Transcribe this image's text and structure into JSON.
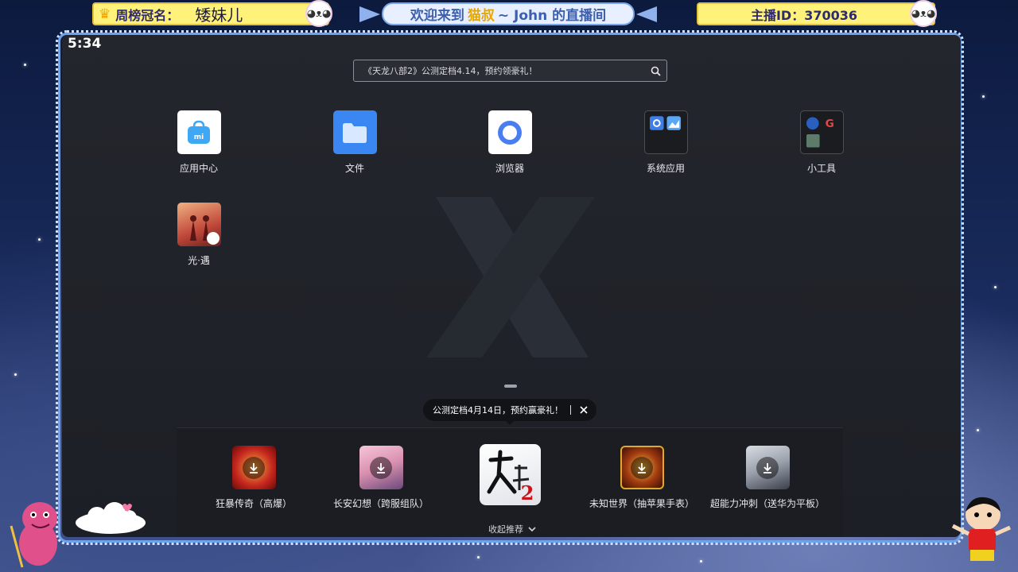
{
  "overlay": {
    "rank_label": "周榜冠名：",
    "rank_name": "矮妹儿",
    "welcome_prefix": "欢迎来到",
    "welcome_highlight": "猫叔",
    "welcome_suffix": "~ John 的直播间",
    "host_id": "主播ID：370036"
  },
  "status_bar": {
    "time": "5:34"
  },
  "search": {
    "placeholder": "《天龙八部2》公测定档4.14，预约领豪礼！",
    "icon": "search-icon"
  },
  "apps": [
    {
      "label": "应用中心",
      "icon": "app-center-icon"
    },
    {
      "label": "文件",
      "icon": "folder-icon"
    },
    {
      "label": "浏览器",
      "icon": "browser-icon"
    },
    {
      "label": "系统应用",
      "icon": "system-apps-folder-icon"
    },
    {
      "label": "小工具",
      "icon": "tools-folder-icon"
    },
    {
      "label": "光·遇",
      "icon": "sky-game-icon"
    }
  ],
  "tooltip": {
    "text": "公测定档4月14日，预约赢豪礼！",
    "close_icon": "close-icon"
  },
  "recommended": [
    {
      "label": "狂暴传奇（高爆）",
      "icon": "download-icon",
      "color": "#c4261e"
    },
    {
      "label": "长安幻想（跨服组队）",
      "icon": "download-icon",
      "color": "#d98fb0"
    },
    {
      "label": "",
      "icon": "tianlong-2-icon",
      "color": "#e9ecef"
    },
    {
      "label": "未知世界（抽苹果手表）",
      "icon": "download-icon",
      "color": "#7a2a10"
    },
    {
      "label": "超能力冲刺（送华为平板）",
      "icon": "download-icon",
      "color": "#9aa0ab"
    }
  ],
  "collapse": {
    "label": "收起推荐",
    "icon": "chevron-down-icon"
  },
  "colors": {
    "accent_yellow": "#fff27a",
    "frame_blue": "#6fa2ee",
    "screen_bg": "#1f2228"
  }
}
